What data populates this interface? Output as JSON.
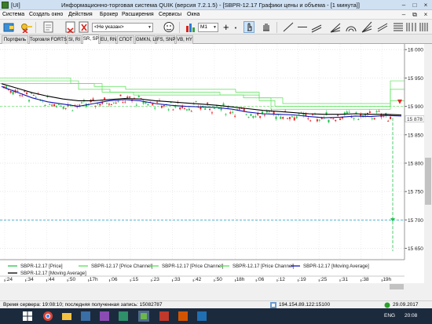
{
  "window": {
    "title_prefix": "[UI]",
    "title_main": "Информационно-торговая система QUIK (версия 7.2.1.5) - [SBPR-12.17 Графики цены и объема - [1 минута]]"
  },
  "menu": [
    "Система",
    "Создать окно",
    "Действия",
    "Брокер",
    "Расширения",
    "Сервисы",
    "Окна"
  ],
  "toolbar": {
    "account_combo": "<Не указан>",
    "interval_combo": "M1"
  },
  "tabs": [
    {
      "label": "Портфель",
      "active": false
    },
    {
      "label": "Торговля FORTS",
      "active": false
    },
    {
      "label": "SI, RI",
      "active": false
    },
    {
      "label": "SR, SP",
      "active": true
    },
    {
      "label": "EU, RN",
      "active": false
    },
    {
      "label": "СПОТ",
      "active": false
    },
    {
      "label": "GMKN, LK",
      "active": false
    },
    {
      "label": "FS, SNP",
      "active": false
    },
    {
      "label": "VB, HY",
      "active": false
    }
  ],
  "chart": {
    "price_labels": [
      "16 000",
      "15 950",
      "15 900",
      "15 850",
      "15 800",
      "15 750",
      "15 700",
      "15 650"
    ],
    "current_price": "15 878",
    "time_labels": [
      ":24",
      ":34",
      ":44",
      ":50",
      "17h",
      ":06",
      ":15",
      ":23",
      ":33",
      ":42",
      ":50",
      "18h",
      ":06",
      ":12",
      ":19",
      ":25",
      ":31",
      ":38",
      "19h"
    ],
    "legend": [
      "SBPR-12.17 [Price]",
      "SBPR-12.17 [Price Channel]",
      "SBPR-12.17 [Price Channel]",
      "SBPR-12.17 [Price Channel]",
      "SBPR-12.17 [Moving Average]",
      "SBPR-12.17 [Moving Average]"
    ],
    "colors": {
      "candle_up": "#22c24a",
      "candle_down": "#e8262a",
      "price_channel": "#55e155",
      "ma_fast": "#1313b8",
      "ma_slow": "#000000",
      "dashed_level": "#22a0c8"
    }
  },
  "chart_data": {
    "type": "line",
    "xlabel": "",
    "ylabel": "",
    "ylim": [
      15630,
      16010
    ],
    "series": [
      {
        "name": "SBPR-12.17 [Moving Average]",
        "values": [
          15935,
          15925,
          15915,
          15908,
          15904,
          15900,
          15905,
          15910,
          15912,
          15910,
          15905,
          15902,
          15900,
          15899,
          15898,
          15895,
          15890,
          15887,
          15886,
          15885,
          15882,
          15880,
          15881,
          15883,
          15882,
          15884,
          15883
        ]
      },
      {
        "name": "SBPR-12.17 [Moving Average]",
        "values": [
          15940,
          15932,
          15924,
          15918,
          15913,
          15910,
          15910,
          15912,
          15914,
          15913,
          15910,
          15908,
          15906,
          15904,
          15902,
          15899,
          15896,
          15893,
          15891,
          15889,
          15887,
          15886,
          15886,
          15887,
          15886,
          15886,
          15885
        ]
      }
    ]
  },
  "status": {
    "server_time": "Время сервера: 19:08:10; последняя полученная запись: 15082787",
    "connection": "194.154.89.122:15100",
    "date": "29.09.2017"
  },
  "taskbar": {
    "lang": "ENG",
    "time": "20:08"
  }
}
